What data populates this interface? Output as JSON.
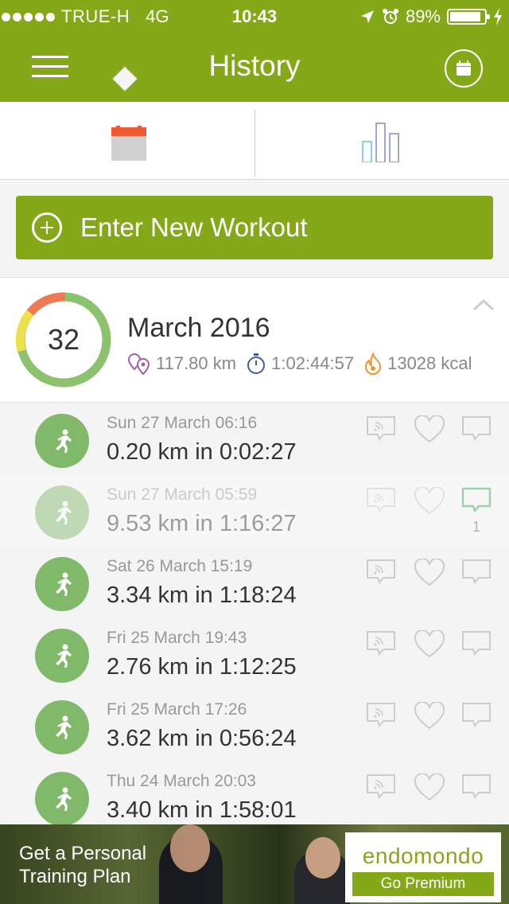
{
  "status_bar": {
    "carrier": "TRUE-H",
    "network": "4G",
    "time": "10:43",
    "battery": "89%"
  },
  "header": {
    "title": "History"
  },
  "enter_workout": {
    "label": "Enter New Workout"
  },
  "summary": {
    "count": "32",
    "month": "March 2016",
    "distance": "117.80 km",
    "duration": "1:02:44:57",
    "calories": "13028 kcal"
  },
  "workouts": [
    {
      "date": "Sun 27 March 06:16",
      "summary": "0.20 km in 0:02:27",
      "comments": ""
    },
    {
      "date": "Sun 27 March 05:59",
      "summary": "9.53 km in 1:16:27",
      "comments": "1"
    },
    {
      "date": "Sat 26 March 15:19",
      "summary": "3.34 km in 1:18:24",
      "comments": ""
    },
    {
      "date": "Fri 25 March 19:43",
      "summary": "2.76 km in 1:12:25",
      "comments": ""
    },
    {
      "date": "Fri 25 March 17:26",
      "summary": "3.62 km in 0:56:24",
      "comments": ""
    },
    {
      "date": "Thu 24 March 20:03",
      "summary": "3.40 km in 1:58:01",
      "comments": ""
    }
  ],
  "ad": {
    "headline_line1": "Get a Personal",
    "headline_line2": "Training Plan",
    "brand": "endomondo",
    "cta": "Go Premium"
  },
  "colors": {
    "brand_green": "#84a818",
    "avatar_green": "#80b96a",
    "ring_orange": "#f07b52",
    "ring_yellow": "#eee04a",
    "ring_green": "#8cc26d"
  }
}
